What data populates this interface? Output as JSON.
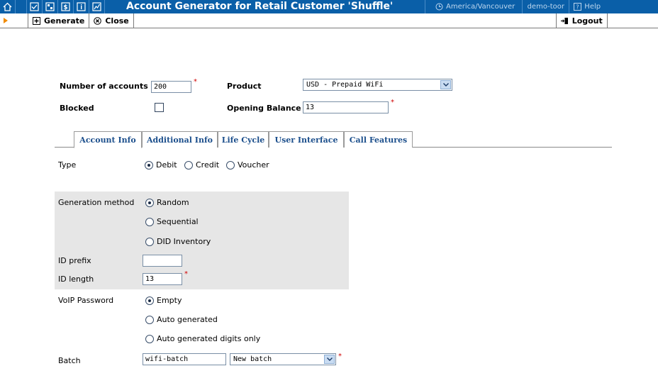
{
  "topbar": {
    "title": "Account Generator for Retail Customer 'Shuffle'",
    "timezone": "America/Vancouver",
    "user": "demo-toor",
    "help": "Help"
  },
  "toolbar": {
    "generate": "Generate",
    "close": "Close",
    "logout": "Logout"
  },
  "form": {
    "num_accounts_label": "Number of accounts",
    "num_accounts_value": "200",
    "product_label": "Product",
    "product_value": "USD - Prepaid WiFi",
    "blocked_label": "Blocked",
    "opening_balance_label": "Opening Balance",
    "opening_balance_value": "13"
  },
  "tabs": [
    "Account Info",
    "Additional Info",
    "Life Cycle",
    "User Interface",
    "Call Features"
  ],
  "account_info": {
    "type_label": "Type",
    "type_options": [
      "Debit",
      "Credit",
      "Voucher"
    ],
    "gen_method_label": "Generation method",
    "gen_methods": [
      "Random",
      "Sequential",
      "DID Inventory"
    ],
    "id_prefix_label": "ID prefix",
    "id_prefix_value": "",
    "id_length_label": "ID length",
    "id_length_value": "13",
    "voip_label": "VoIP Password",
    "voip_options": [
      "Empty",
      "Auto generated",
      "Auto generated digits only"
    ],
    "batch_label": "Batch",
    "batch_value": "wifi-batch",
    "batch_select": "New batch"
  },
  "required_mark": "*",
  "colors": {
    "topbar": "#0a5fa8",
    "accent": "#f08a00",
    "tab_text": "#1c4f8c",
    "required": "#d00000"
  }
}
